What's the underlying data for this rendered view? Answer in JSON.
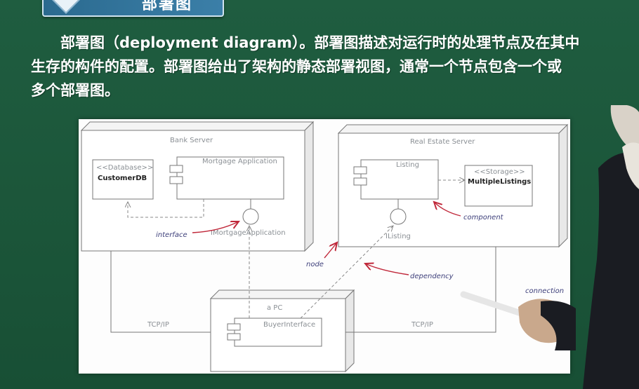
{
  "slide": {
    "title": "部署图"
  },
  "paragraph": {
    "line1": "部署图（deployment diagram）。部署图描述对运行时的处理节点及在其中",
    "line2": "生存的构件的配置。部署图给出了架构的静态部署视图，通常一个节点包含一个或",
    "line3": "多个部署图。"
  },
  "diagram": {
    "bank_server": {
      "label": "Bank Server",
      "database_stereotype": "<<Database>>",
      "database_name": "CustomerDB",
      "component": "Mortgage Application",
      "interface": "IMortgageApplication"
    },
    "real_estate_server": {
      "label": "Real Estate Server",
      "component": "Listing",
      "storage_stereotype": "<<Storage>>",
      "storage_name": "MultipleListings",
      "interface": "IListing"
    },
    "pc": {
      "label": "a PC",
      "component": "BuyerInterface"
    },
    "links": {
      "left": "TCP/IP",
      "right": "TCP/IP"
    },
    "annotations": {
      "interface": "interface",
      "component": "component",
      "node": "node",
      "dependency": "dependency",
      "connection": "connection"
    }
  }
}
